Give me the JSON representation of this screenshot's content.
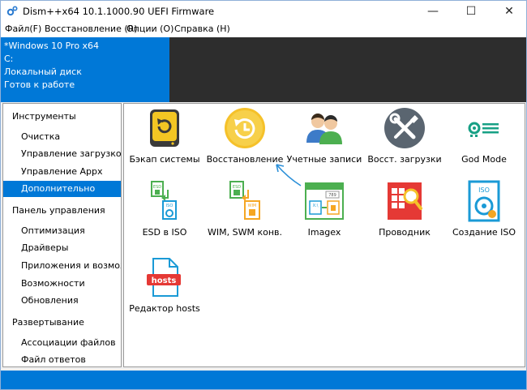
{
  "window": {
    "title": "Dism++x64 10.1.1000.90 UEFI Firmware",
    "controls": {
      "minimize": "—",
      "maximize": "☐",
      "close": "✕"
    }
  },
  "menu": [
    {
      "label": "Файл(F)"
    },
    {
      "label": "Восстановление (R)"
    },
    {
      "label": "Опции (O)"
    },
    {
      "label": "Справка (H)"
    }
  ],
  "system_info": {
    "os": "*Windows 10 Pro x64",
    "drive": "C:",
    "disk_type": "Локальный диск",
    "status": "Готов к работе"
  },
  "sidebar": {
    "sections": [
      {
        "title": "Инструменты",
        "items": [
          "Очистка",
          "Управление загрузкой",
          "Управление Appx",
          "Дополнительно"
        ]
      },
      {
        "title": "Панель управления",
        "items": [
          "Оптимизация",
          "Драйверы",
          "Приложения и возможнос",
          "Возможности",
          "Обновления"
        ]
      },
      {
        "title": "Развертывание",
        "items": [
          "Ассоциации файлов",
          "Файл ответов"
        ]
      }
    ],
    "selected": "Дополнительно"
  },
  "tools": [
    {
      "label": "Бэкап системы",
      "icon": "backup-drive-icon"
    },
    {
      "label": "Восстановление",
      "icon": "restore-clock-icon"
    },
    {
      "label": "Учетные записи",
      "icon": "users-icon"
    },
    {
      "label": "Восст. загрузки",
      "icon": "repair-tools-icon"
    },
    {
      "label": "God Mode",
      "icon": "god-mode-icon"
    },
    {
      "label": "ESD в ISO",
      "icon": "esd-to-iso-icon"
    },
    {
      "label": "WIM, SWM конв.",
      "icon": "wim-convert-icon"
    },
    {
      "label": "Imagex",
      "icon": "imagex-icon"
    },
    {
      "label": "Проводник",
      "icon": "explorer-icon"
    },
    {
      "label": "Создание ISO",
      "icon": "create-iso-icon"
    },
    {
      "label": "Редактор hosts",
      "icon": "hosts-editor-icon"
    }
  ],
  "colors": {
    "accent": "#0078d7",
    "dark_panel": "#2d2d2d",
    "annotation_arrow": "#2a8fd8"
  }
}
